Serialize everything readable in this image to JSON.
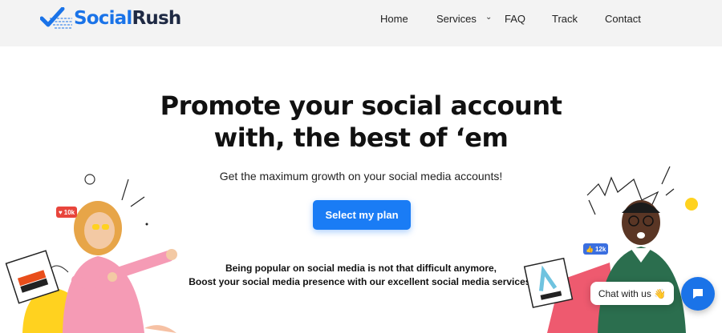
{
  "brand": {
    "part1": "Social",
    "part2": "Rush",
    "colors": {
      "blue": "#1a73e8",
      "dark": "#1f2a44"
    }
  },
  "nav": {
    "home": "Home",
    "services": "Services",
    "faq": "FAQ",
    "track": "Track",
    "contact": "Contact"
  },
  "hero": {
    "title_line1": "Promote your social account",
    "title_line2": "with, the best of ‘em",
    "subtitle": "Get the maximum growth on your social media accounts!",
    "cta": "Select my plan",
    "line1": "Being popular on social media is not that difficult anymore,",
    "line2": "Boost your social media presence with our excellent social media services."
  },
  "badges": {
    "left": "10k",
    "right": "12k"
  },
  "chat": {
    "label": "Chat with us",
    "emoji": "👋"
  },
  "icons": [
    "logo-check-icon",
    "chevron-down-icon",
    "heart-icon",
    "thumbs-up-icon",
    "chat-icon"
  ]
}
